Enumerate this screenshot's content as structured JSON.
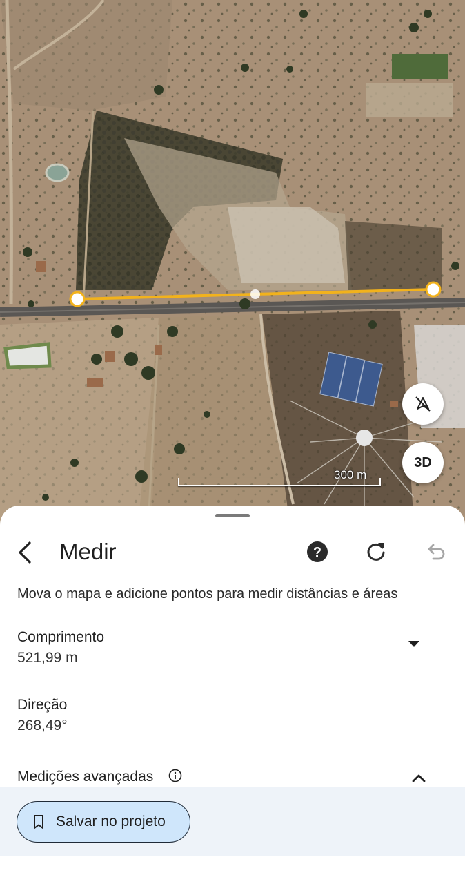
{
  "map": {
    "scale_label": "300 m",
    "view_3d_label": "3D",
    "compass_icon": "compass-off-icon",
    "measure_line_color": "#f2b21c"
  },
  "sheet": {
    "title": "Medir",
    "instruction": "Mova o mapa e adicione pontos para medir distâncias e áreas",
    "length": {
      "label": "Comprimento",
      "value": "521,99 m"
    },
    "direction": {
      "label": "Direção",
      "value": "268,49°"
    },
    "advanced": {
      "label": "Medições avançadas"
    },
    "save_button": "Salvar no projeto",
    "icons": {
      "back": "back-arrow-icon",
      "help": "help-icon",
      "refresh": "refresh-icon",
      "undo": "undo-icon",
      "dropdown": "dropdown-arrow-icon",
      "info": "info-icon",
      "expand": "chevron-up-icon",
      "bookmark": "bookmark-icon"
    }
  }
}
